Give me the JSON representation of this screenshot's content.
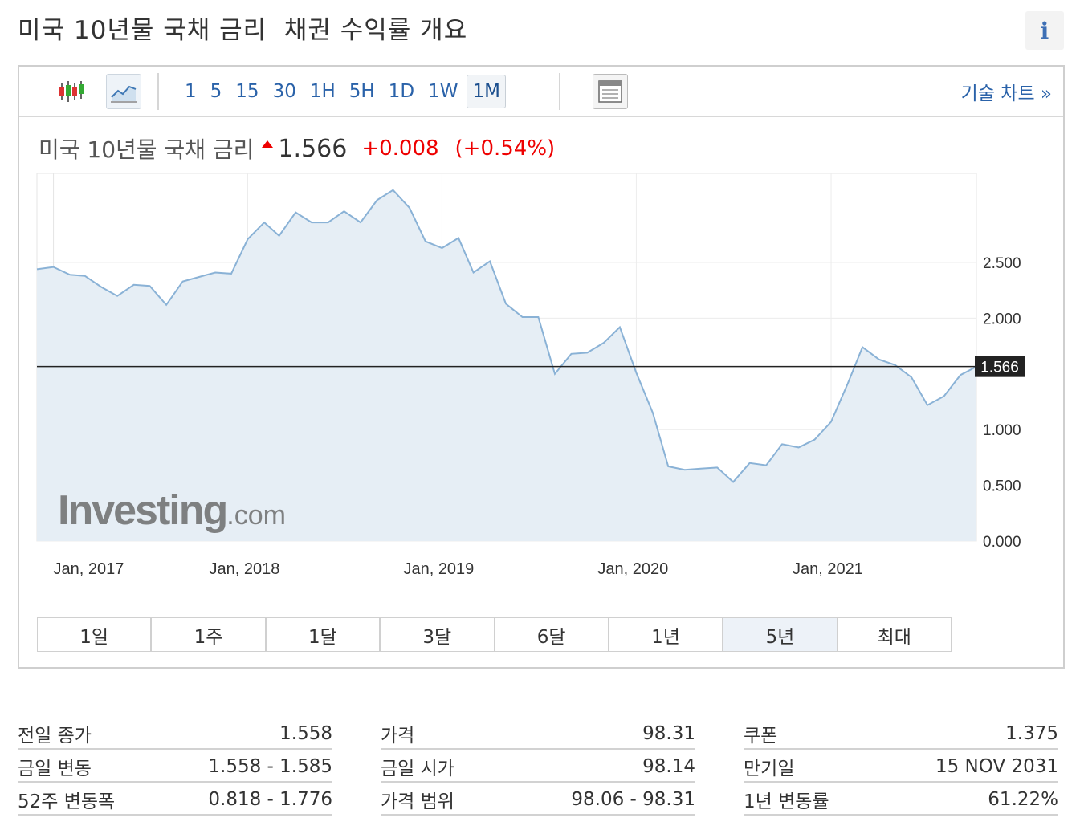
{
  "header": {
    "title": "미국 10년물 국채 금리  채권 수익률 개요",
    "info_label": "i"
  },
  "toolbar": {
    "intervals": [
      "1",
      "5",
      "15",
      "30",
      "1H",
      "5H",
      "1D",
      "1W",
      "1M"
    ],
    "active_interval": "1M",
    "tech_chart_label": "기술 차트 »"
  },
  "quote": {
    "name": "미국 10년물 국채 금리",
    "price": "1.566",
    "change": "+0.008",
    "change_pct": "(+0.54%)",
    "direction": "up"
  },
  "chart_data": {
    "type": "area",
    "title": "",
    "xlabel": "",
    "ylabel": "",
    "x_tick_labels": [
      "Jan, 2017",
      "Jan, 2018",
      "Jan, 2019",
      "Jan, 2020",
      "Jan, 2021"
    ],
    "y_tick_labels": [
      "2.500",
      "2.000",
      "1.000",
      "0.500",
      "0.000"
    ],
    "y_ticks": [
      2.5,
      2.0,
      1.0,
      0.5,
      0.0
    ],
    "ylim": [
      0,
      3.3
    ],
    "current_value": 1.566,
    "current_value_label": "1.566",
    "watermark": "Investing.com",
    "series": [
      {
        "x": [
          "2016-12",
          "2017-01",
          "2017-02",
          "2017-03",
          "2017-04",
          "2017-05",
          "2017-06",
          "2017-07",
          "2017-08",
          "2017-09",
          "2017-10",
          "2017-11",
          "2017-12",
          "2018-01",
          "2018-02",
          "2018-03",
          "2018-04",
          "2018-05",
          "2018-06",
          "2018-07",
          "2018-08",
          "2018-09",
          "2018-10",
          "2018-11",
          "2018-12",
          "2019-01",
          "2019-02",
          "2019-03",
          "2019-04",
          "2019-05",
          "2019-06",
          "2019-07",
          "2019-08",
          "2019-09",
          "2019-10",
          "2019-11",
          "2019-12",
          "2020-01",
          "2020-02",
          "2020-03",
          "2020-04",
          "2020-05",
          "2020-06",
          "2020-07",
          "2020-08",
          "2020-09",
          "2020-10",
          "2020-11",
          "2020-12",
          "2021-01",
          "2021-02",
          "2021-03",
          "2021-04",
          "2021-05",
          "2021-06",
          "2021-07",
          "2021-08",
          "2021-09",
          "2021-10"
        ],
        "values": [
          2.44,
          2.46,
          2.39,
          2.38,
          2.28,
          2.2,
          2.3,
          2.29,
          2.12,
          2.33,
          2.37,
          2.41,
          2.4,
          2.71,
          2.86,
          2.74,
          2.95,
          2.86,
          2.86,
          2.96,
          2.86,
          3.06,
          3.15,
          2.99,
          2.69,
          2.63,
          2.72,
          2.41,
          2.51,
          2.13,
          2.01,
          2.01,
          1.5,
          1.68,
          1.69,
          1.78,
          1.92,
          1.51,
          1.15,
          0.67,
          0.64,
          0.65,
          0.66,
          0.53,
          0.7,
          0.68,
          0.87,
          0.84,
          0.91,
          1.07,
          1.41,
          1.74,
          1.63,
          1.58,
          1.47,
          1.22,
          1.3,
          1.49,
          1.566
        ]
      }
    ],
    "grid": true,
    "legend": "none"
  },
  "ranges": {
    "items": [
      "1일",
      "1주",
      "1달",
      "3달",
      "6달",
      "1년",
      "5년",
      "최대"
    ],
    "active": "5년"
  },
  "stats": {
    "col1": [
      {
        "label": "전일 종가",
        "value": "1.558"
      },
      {
        "label": "금일 변동",
        "value": "1.558 - 1.585"
      },
      {
        "label": "52주 변동폭",
        "value": "0.818 - 1.776"
      }
    ],
    "col2": [
      {
        "label": "가격",
        "value": "98.31"
      },
      {
        "label": "금일 시가",
        "value": "98.14"
      },
      {
        "label": "가격 범위",
        "value": "98.06 - 98.31"
      }
    ],
    "col3": [
      {
        "label": "쿠폰",
        "value": "1.375"
      },
      {
        "label": "만기일",
        "value": "15 NOV 2031"
      },
      {
        "label": "1년 변동률",
        "value": "61.22%"
      }
    ]
  },
  "colors": {
    "accent": "#2a62a9",
    "up": "#e00000",
    "line": "#8ab2d6",
    "fill": "#e6eef5",
    "current_line": "#222222"
  }
}
